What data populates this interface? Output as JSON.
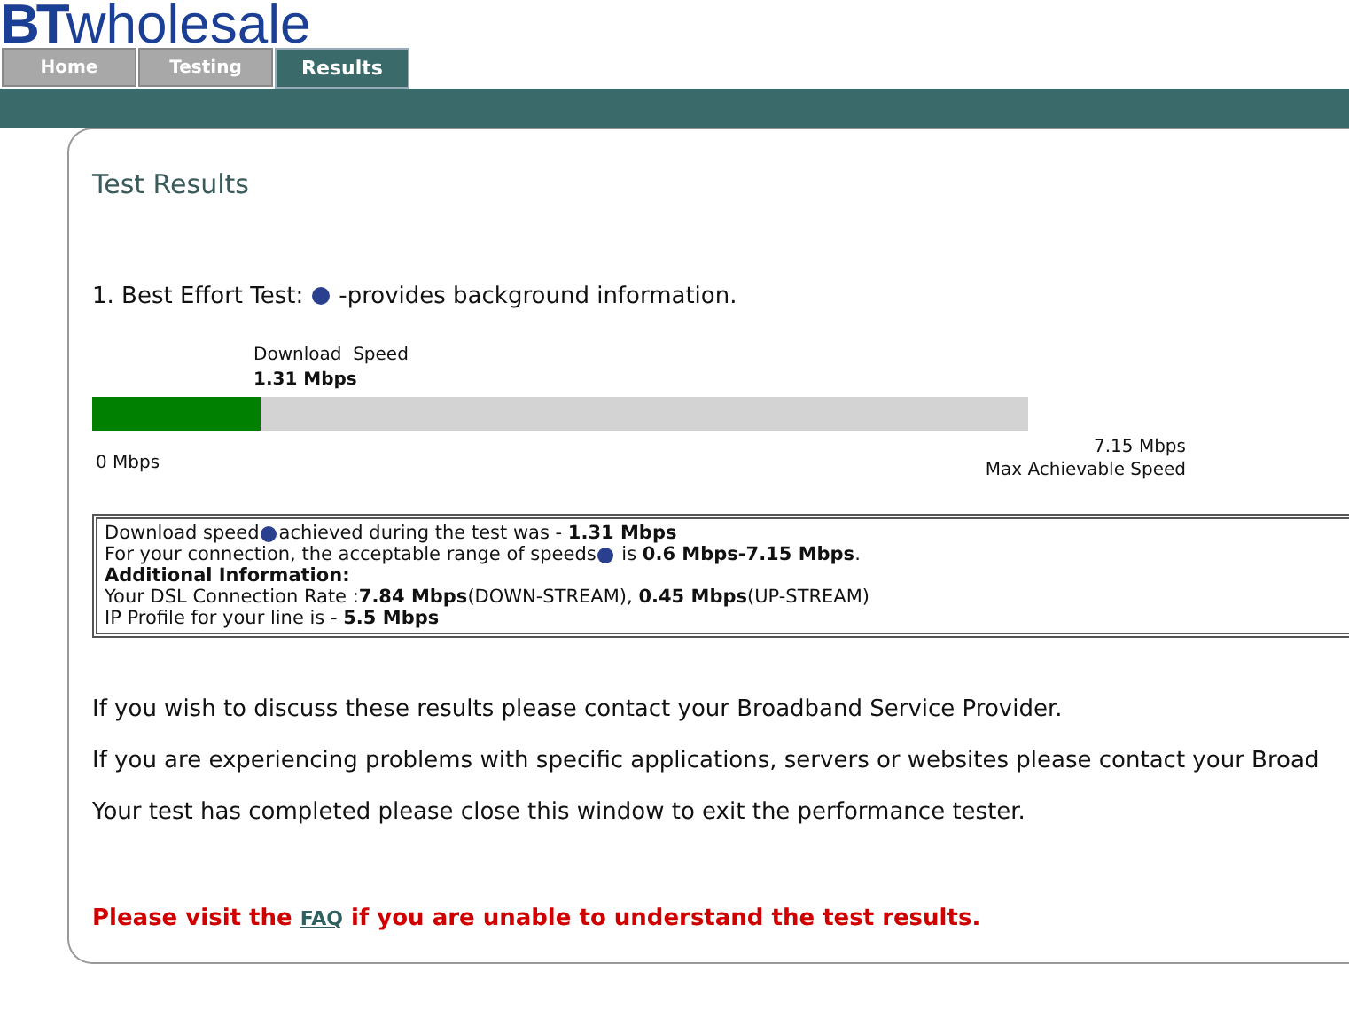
{
  "logo": {
    "prefix": "BT",
    "word": "wholesale"
  },
  "tabs": [
    {
      "label": "Home",
      "selected": false
    },
    {
      "label": "Testing",
      "selected": false
    },
    {
      "label": "Results",
      "selected": true
    }
  ],
  "heading": "Test Results",
  "test": {
    "title": "1. Best Effort Test:",
    "note": "-provides background information.",
    "meter_label": "Download  Speed",
    "meter_value": "1.31 Mbps",
    "level": 0.18,
    "min_label": "0 Mbps",
    "max_label": "7.15 Mbps",
    "max_caption": "Max Achievable Speed"
  },
  "details": [
    {
      "text": "Download speed",
      "rest": "achieved during the test was - **1.31 Mbps**"
    },
    {
      "text": "For your connection, the acceptable range of speeds",
      "rest": " is **0.6 Mbps-7.15 Mbps**."
    },
    {
      "text": "**Additional Information:**"
    },
    {
      "text": "Your DSL Connection Rate :**7.84 Mbps**(DOWN-STREAM), **0.45 Mbps**(UP-STREAM)"
    },
    {
      "text": "IP Profile for your line is - **5.5 Mbps**"
    }
  ],
  "paragraphs": [
    "If you wish to discuss these results please contact your Broadband Service Provider.",
    "If you are experiencing problems with specific applications, servers or websites please contact your Broad",
    "Your test has completed please close this window to exit the performance tester."
  ],
  "notice": {
    "before": "Please visit the",
    "link": "FAQ",
    "after": "if you are unable to understand the test results."
  }
}
